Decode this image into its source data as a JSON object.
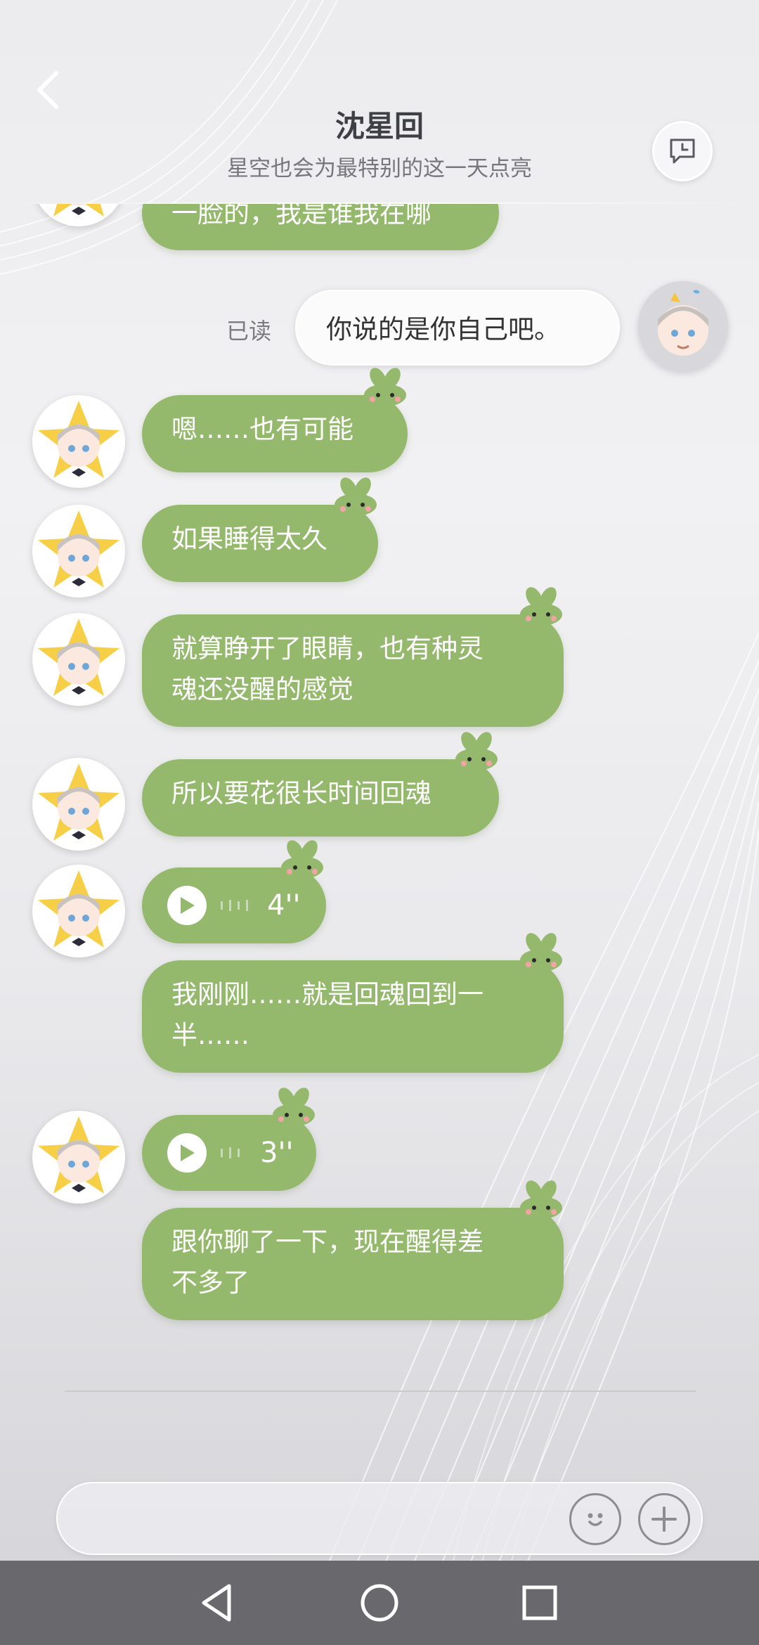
{
  "header": {
    "title": "沈星回",
    "subtitle": "星空也会为最特别的这一天点亮"
  },
  "messages": [
    {
      "from": "npc",
      "kind": "text",
      "text": "一脸的，我是谁我在哪"
    },
    {
      "from": "user",
      "kind": "text",
      "text": "你说的是你自己吧。",
      "status": "已读"
    },
    {
      "from": "npc",
      "kind": "text",
      "text": "嗯……也有可能"
    },
    {
      "from": "npc",
      "kind": "text",
      "text": "如果睡得太久"
    },
    {
      "from": "npc",
      "kind": "text",
      "lines": [
        "就算睁开了眼睛，也有种灵",
        "魂还没醒的感觉"
      ]
    },
    {
      "from": "npc",
      "kind": "text",
      "text": "所以要花很长时间回魂"
    },
    {
      "from": "npc",
      "kind": "voice",
      "duration": "4''"
    },
    {
      "from": "npc",
      "kind": "text",
      "lines": [
        "我刚刚……就是回魂回到一",
        "半……"
      ]
    },
    {
      "from": "npc",
      "kind": "voice",
      "duration": "3''"
    },
    {
      "from": "npc",
      "kind": "text",
      "lines": [
        "跟你聊了一下，现在醒得差",
        "不多了"
      ]
    }
  ],
  "input": {
    "value": "",
    "placeholder": ""
  },
  "icons": {
    "back": "chevron-left-icon",
    "chat_history": "chat-bubble-icon",
    "emoji": "smiley-icon",
    "plus": "plus-icon",
    "nav_back": "triangle-back-icon",
    "nav_home": "circle-home-icon",
    "nav_recent": "square-recent-icon",
    "play": "play-icon"
  },
  "colors": {
    "npc_bubble": "#95b96c",
    "user_bubble": "#fbfbfc",
    "nav_bar": "#69696d"
  }
}
